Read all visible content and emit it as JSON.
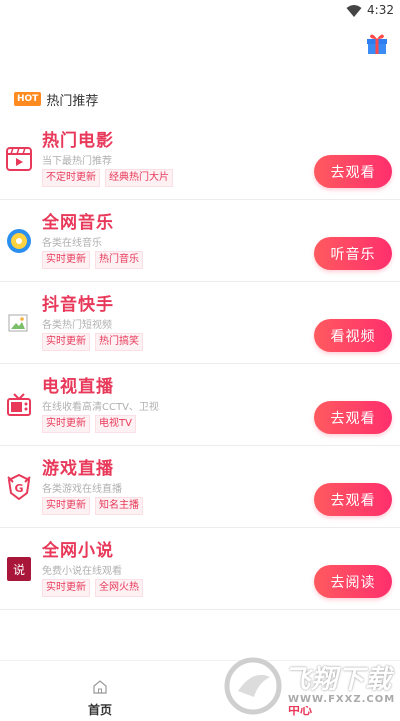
{
  "status_bar": {
    "time": "4:32",
    "wifi_icon": "wifi-icon"
  },
  "header": {
    "gift_icon": "gift-icon"
  },
  "hot_section": {
    "badge": "HOT",
    "title": "热门推荐"
  },
  "items": [
    {
      "title": "热门电影",
      "desc": "当下最热门推荐",
      "tags": [
        "不定时更新",
        "经典热门大片"
      ],
      "button": "去观看",
      "icon": "film-icon"
    },
    {
      "title": "全网音乐",
      "desc": "各类在线音乐",
      "tags": [
        "实时更新",
        "热门音乐"
      ],
      "button": "听音乐",
      "icon": "music-disc-icon"
    },
    {
      "title": "抖音快手",
      "desc": "各类热门短视频",
      "tags": [
        "实时更新",
        "热门搞笑"
      ],
      "button": "看视频",
      "icon": "broken-image-icon"
    },
    {
      "title": "电视直播",
      "desc": "在线收看高清CCTV、卫视",
      "tags": [
        "实时更新",
        "电视TV"
      ],
      "button": "去观看",
      "icon": "tv-icon"
    },
    {
      "title": "游戏直播",
      "desc": "各类游戏在线直播",
      "tags": [
        "实时更新",
        "知名主播"
      ],
      "button": "去观看",
      "icon": "game-shield-icon"
    },
    {
      "title": "全网小说",
      "desc": "免费小说在线观看",
      "tags": [
        "实时更新",
        "全网火热"
      ],
      "button": "去阅读",
      "icon": "novel-icon"
    }
  ],
  "tabbar": {
    "home_label": "首页",
    "center_label": "中心"
  },
  "watermark": {
    "text": "飞翔下载",
    "url": "WWW.FXXZ.COM"
  },
  "colors": {
    "accent": "#e8395a",
    "button_gradient_start": "#ff5a5f",
    "button_gradient_end": "#ff2f6d",
    "hot_badge": "#ff8a1f"
  }
}
